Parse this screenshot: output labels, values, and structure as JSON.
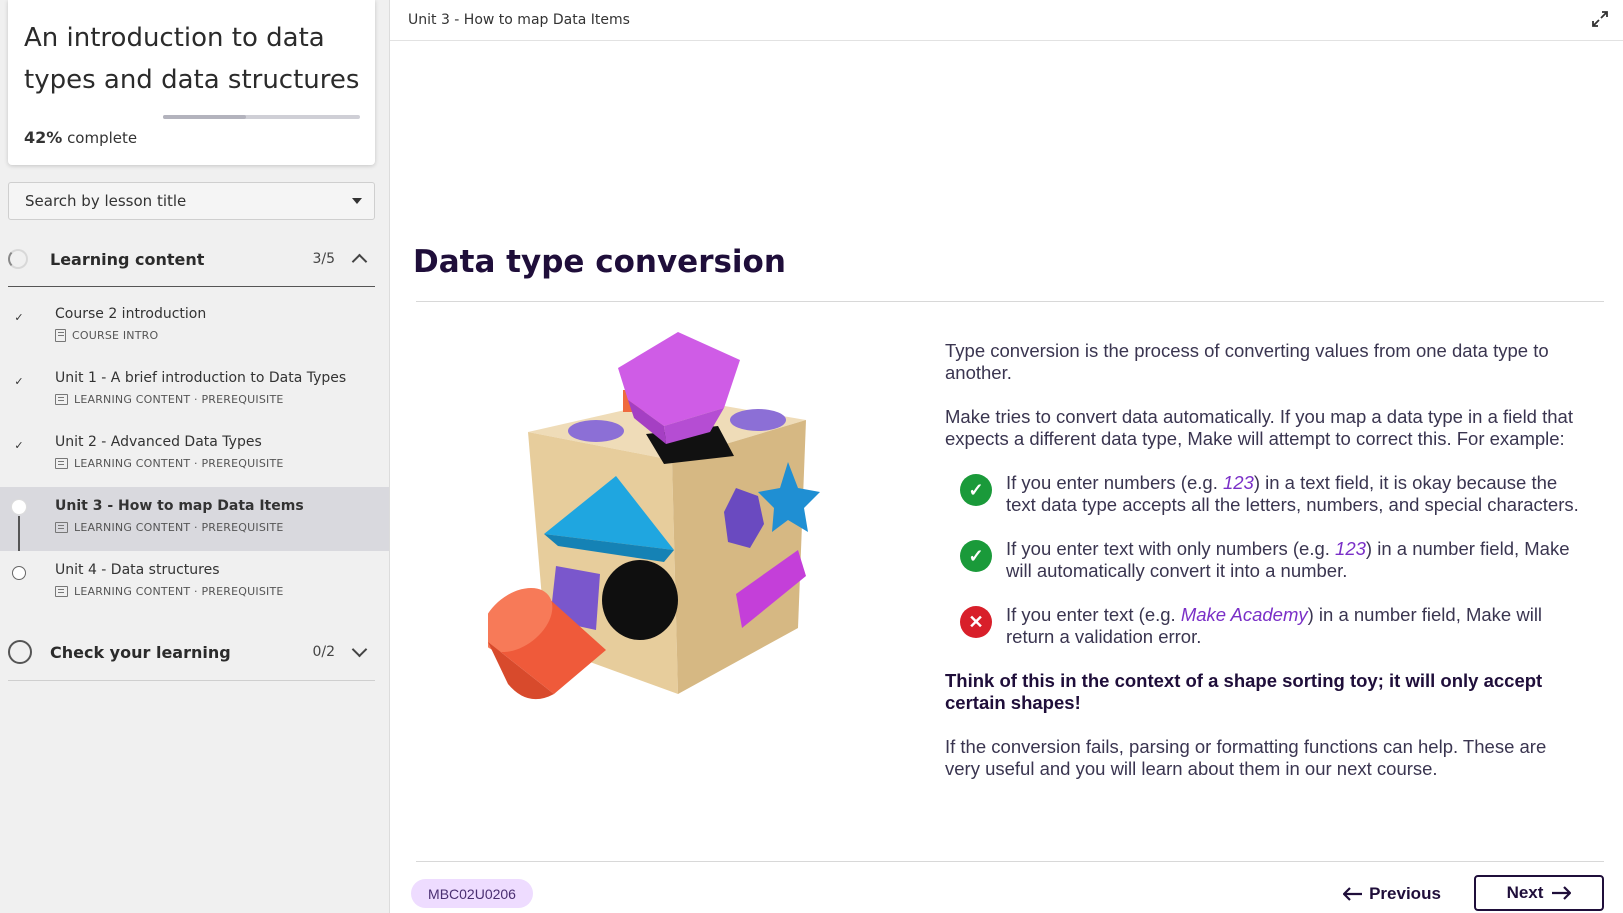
{
  "course": {
    "title": "An introduction to data types and data structures",
    "progress_percent": 42,
    "progress_pct_label": "42%",
    "progress_suffix": " complete"
  },
  "search": {
    "placeholder": "Search by lesson title"
  },
  "sections": [
    {
      "title": "Learning content",
      "count": "3/5",
      "expanded": true
    },
    {
      "title": "Check your learning",
      "count": "0/2",
      "expanded": false
    }
  ],
  "lessons": [
    {
      "title": "Course 2 introduction",
      "meta": "COURSE INTRO",
      "status": "done"
    },
    {
      "title": "Unit 1 - A brief introduction to Data Types",
      "meta": "LEARNING CONTENT · PREREQUISITE",
      "status": "done"
    },
    {
      "title": "Unit 2 - Advanced Data Types",
      "meta": "LEARNING CONTENT · PREREQUISITE",
      "status": "done"
    },
    {
      "title": "Unit 3 - How to map Data Items",
      "meta": "LEARNING CONTENT · PREREQUISITE",
      "status": "current"
    },
    {
      "title": "Unit 4 - Data structures",
      "meta": "LEARNING CONTENT · PREREQUISITE",
      "status": "todo"
    }
  ],
  "topbar": {
    "breadcrumb": "Unit 3 - How to map Data Items"
  },
  "main": {
    "title": "Data type conversion",
    "para1": "Type conversion is the process of converting values from one data type to another.",
    "para2": "Make tries to convert data automatically. If you map a data type in a field that expects a different data type, Make will attempt to correct this. For example:",
    "items": [
      {
        "pre": "If you enter numbers (e.g. ",
        "hl": "123",
        "post": ") in a text field, it is okay because the text data type accepts all the letters, numbers, and special characters.",
        "status": "ok"
      },
      {
        "pre": "If you enter text with only numbers (e.g. ",
        "hl": "123",
        "post": ") in a number field, Make will automatically convert it into a number.",
        "status": "ok"
      },
      {
        "pre": "If you enter text (e.g. ",
        "hl": "Make Academy",
        "post": ") in a number field, Make will return a validation error.",
        "status": "err"
      }
    ],
    "bold_para": "Think of this in the context of a shape sorting toy; it will only accept certain shapes!",
    "para3": "If the conversion fails, parsing or formatting functions can help. These are very useful and you will learn about them in our next course."
  },
  "footer": {
    "code": "MBC02U0206",
    "prev_label": "Previous",
    "next_label": "Next"
  },
  "icons": {
    "check": "check-icon",
    "error": "x-icon",
    "expand": "expand-icon",
    "arrow_left": "arrow-left-icon",
    "arrow_right": "arrow-right-icon"
  },
  "colors": {
    "accent_dark": "#1f0e3a",
    "success": "#1a9a3a",
    "error": "#d81f2a",
    "highlight": "#7a2fc7",
    "badge_bg": "#eedcff"
  }
}
